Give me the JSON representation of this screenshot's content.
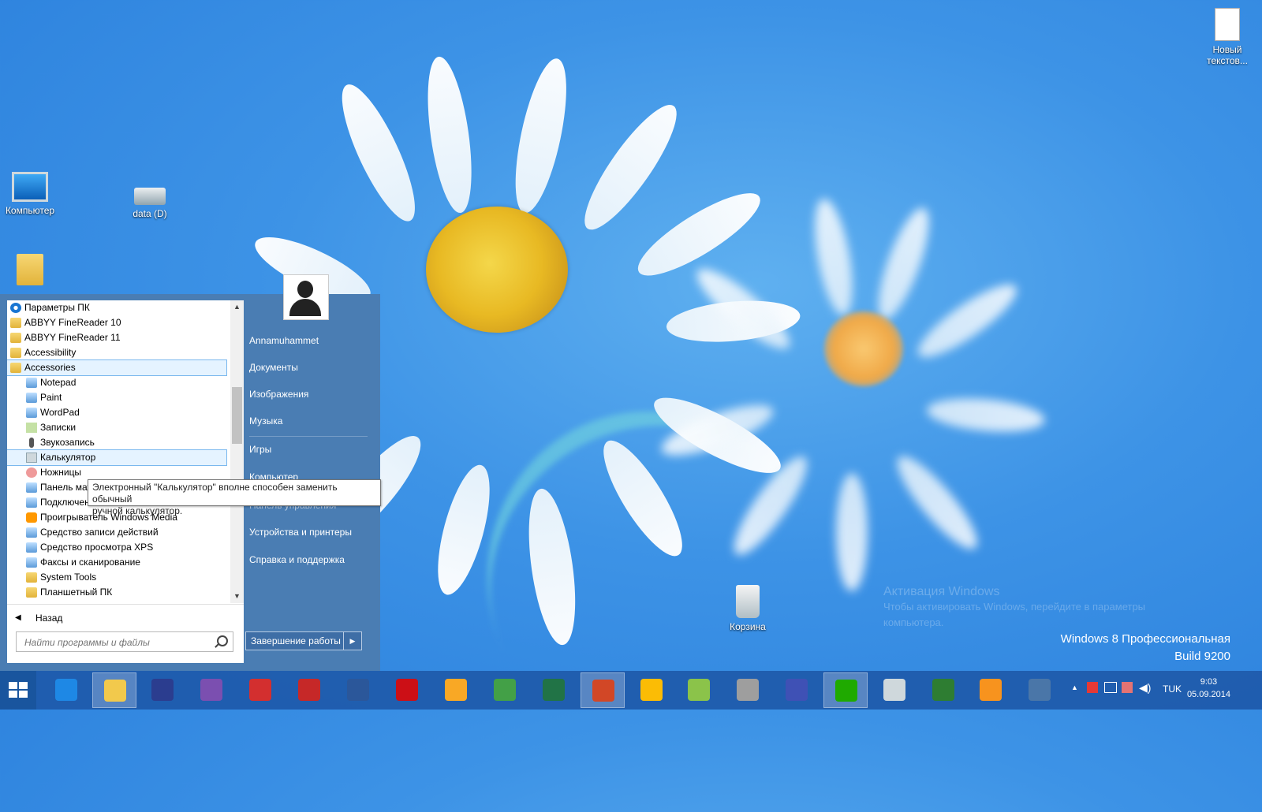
{
  "desktop": {
    "icons": [
      {
        "label": "Новый текстов..."
      },
      {
        "label": "Компьютер"
      },
      {
        "label": "data (D)"
      },
      {
        "label": ""
      },
      {
        "label": "Корзина"
      }
    ]
  },
  "start_menu": {
    "programs": [
      {
        "label": "Параметры ПК",
        "icon": "gear-icon"
      },
      {
        "label": "ABBYY FineReader 10",
        "icon": "folder-icon"
      },
      {
        "label": "ABBYY FineReader 11",
        "icon": "folder-icon"
      },
      {
        "label": "Accessibility",
        "icon": "folder-icon"
      },
      {
        "label": "Accessories",
        "icon": "folder-open-icon"
      },
      {
        "label": "Notepad",
        "icon": "notepad-icon"
      },
      {
        "label": "Paint",
        "icon": "paint-icon"
      },
      {
        "label": "WordPad",
        "icon": "wordpad-icon"
      },
      {
        "label": "Записки",
        "icon": "sticky-notes-icon"
      },
      {
        "label": "Звукозапись",
        "icon": "microphone-icon"
      },
      {
        "label": "Калькулятор",
        "icon": "calculator-icon"
      },
      {
        "label": "Ножницы",
        "icon": "scissors-icon"
      },
      {
        "label": "Панель мат",
        "icon": "math-panel-icon"
      },
      {
        "label": "Подключен",
        "icon": "remote-desktop-icon"
      },
      {
        "label": "Проигрыватель Windows Media",
        "icon": "media-player-icon"
      },
      {
        "label": "Средство записи действий",
        "icon": "steps-recorder-icon"
      },
      {
        "label": "Средство просмотра XPS",
        "icon": "xps-viewer-icon"
      },
      {
        "label": "Факсы и сканирование",
        "icon": "fax-icon"
      },
      {
        "label": "System Tools",
        "icon": "folder-icon"
      },
      {
        "label": "Планшетный ПК",
        "icon": "folder-icon"
      }
    ],
    "back_label": "Назад",
    "search_placeholder": "Найти программы и файлы",
    "right_links": [
      "Annamuhammet",
      "Документы",
      "Изображения",
      "Музыка",
      "Игры",
      "Компьютер",
      "Панель управления",
      "Устройства и принтеры",
      "Справка и поддержка"
    ],
    "shutdown_label": "Завершение работы"
  },
  "tooltip": {
    "line1": "Электронный \"Калькулятор\" вполне способен заменить обычный",
    "line2": "ручной калькулятор."
  },
  "activation": {
    "title": "Активация Windows",
    "line1": "Чтобы активировать Windows, перейдите в параметры",
    "line2": "компьютера."
  },
  "edition": {
    "line1": "Windows 8 Профессиональная",
    "line2": "Build 9200"
  },
  "taskbar": {
    "apps": [
      {
        "name": "internet-explorer-icon",
        "color": "#1e88e5"
      },
      {
        "name": "file-explorer-icon",
        "color": "#f2c94c"
      },
      {
        "name": "save-disk-icon",
        "color": "#2b3d8f"
      },
      {
        "name": "visual-studio-icon",
        "color": "#7b4fb0"
      },
      {
        "name": "app-red-icon",
        "color": "#d32f2f"
      },
      {
        "name": "dictionary-icon",
        "color": "#c62828"
      },
      {
        "name": "word-icon",
        "color": "#2b579a"
      },
      {
        "name": "opera-icon",
        "color": "#cc0f16"
      },
      {
        "name": "app-yellow-icon",
        "color": "#f9a825"
      },
      {
        "name": "map-pin-icon",
        "color": "#43a047"
      },
      {
        "name": "excel-icon",
        "color": "#217346"
      },
      {
        "name": "powerpoint-icon",
        "color": "#d24726"
      },
      {
        "name": "chrome-icon",
        "color": "#fbbc05"
      },
      {
        "name": "app-green-icon",
        "color": "#8bc34a"
      },
      {
        "name": "scanner-icon",
        "color": "#9e9e9e"
      },
      {
        "name": "abc-icon",
        "color": "#3f51b5"
      },
      {
        "name": "mail-agent-icon",
        "color": "#1faa00"
      },
      {
        "name": "calculator-icon",
        "color": "#cfd8dc"
      },
      {
        "name": "font-a-icon",
        "color": "#2e7d32"
      },
      {
        "name": "odnoklassniki-icon",
        "color": "#f7931e"
      },
      {
        "name": "vkontakte-icon",
        "color": "#4a76a8"
      }
    ],
    "language": "TUK",
    "time": "9:03",
    "date": "05.09.2014"
  }
}
